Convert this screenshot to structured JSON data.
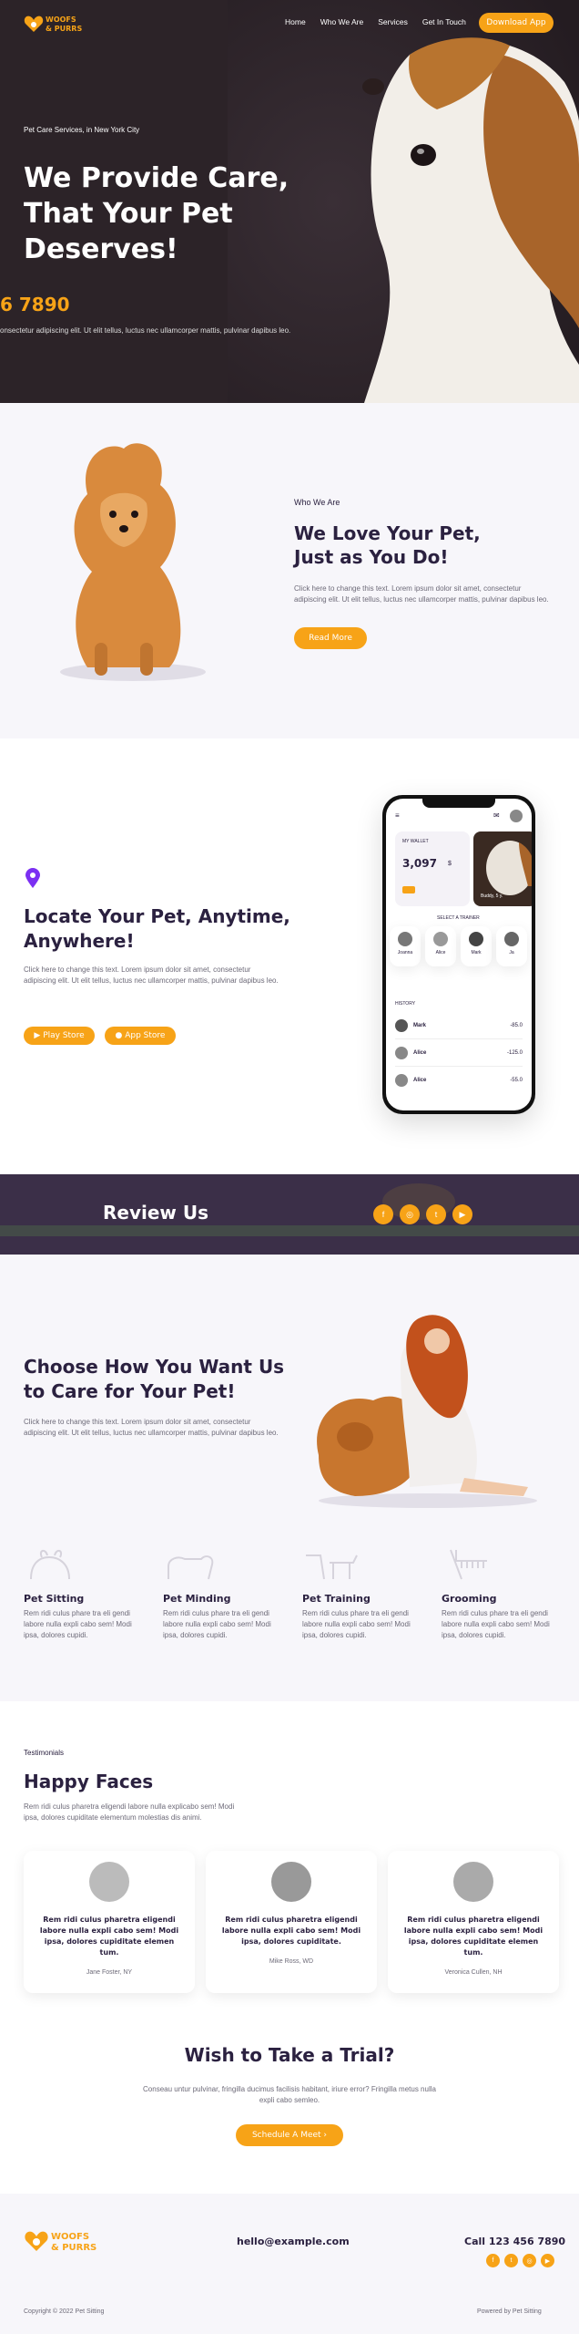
{
  "brand": {
    "logo_line1": "WOOFS",
    "logo_line2": "& PURRS"
  },
  "nav": {
    "items": [
      "Home",
      "Who We Are",
      "Services",
      "Get In Touch"
    ],
    "cta": "Download App"
  },
  "hero": {
    "eyebrow": "Pet Care Services, in New York City",
    "title_l1": "We Provide Care,",
    "title_l2": "That Your Pet",
    "title_l3": "Deserves!",
    "phone": "6 7890",
    "text": "onsectetur adipiscing elit. Ut elit tellus, luctus nec ullamcorper mattis, pulvinar dapibus leo."
  },
  "about": {
    "eyebrow": "Who We Are",
    "title_l1": "We Love Your Pet,",
    "title_l2": "Just as You Do!",
    "text": "Click here to change this text. Lorem ipsum dolor sit amet, consectetur adipiscing elit. Ut elit tellus, luctus nec ullamcorper mattis, pulvinar dapibus leo.",
    "button": "Read More"
  },
  "locate": {
    "title_l1": "Locate Your Pet, Anytime,",
    "title_l2": "Anywhere!",
    "text": "Click here to change this text. Lorem ipsum dolor sit amet, consectetur adipiscing elit. Ut elit tellus, luctus nec ullamcorper mattis, pulvinar dapibus leo.",
    "play": "Play Store",
    "app": "App Store"
  },
  "phone_app": {
    "wallet_label": "MY WALLET",
    "wallet_amount": "3,097",
    "wallet_currency": "$",
    "pet_name": "Buddy, 5 y.",
    "section": "SELECT A TRAINER",
    "trainers": [
      "Joanna",
      "Alice",
      "Mark",
      "Ja"
    ],
    "history_label": "HISTORY",
    "history": [
      {
        "name": "Mark",
        "amount": "-85.0"
      },
      {
        "name": "Alice",
        "amount": "-125.0"
      },
      {
        "name": "Alice",
        "amount": "-55.0"
      }
    ]
  },
  "review": {
    "title": "Review Us"
  },
  "choose": {
    "title_l1": "Choose How You Want Us",
    "title_l2": "to Care for Your Pet!",
    "text": "Click here to change this text. Lorem ipsum dolor sit amet, consectetur adipiscing elit. Ut elit tellus, luctus nec ullamcorper mattis, pulvinar dapibus leo."
  },
  "services": [
    {
      "title": "Pet Sitting",
      "text": "Rem ridi culus phare tra eli gendi labore nulla expli cabo sem! Modi ipsa, dolores cupidi."
    },
    {
      "title": "Pet Minding",
      "text": "Rem ridi culus phare tra eli gendi labore nulla expli cabo sem! Modi ipsa, dolores cupidi."
    },
    {
      "title": "Pet Training",
      "text": "Rem ridi culus phare tra eli gendi labore nulla expli cabo sem! Modi ipsa, dolores cupidi."
    },
    {
      "title": "Grooming",
      "text": "Rem ridi culus phare tra eli gendi labore nulla expli cabo sem! Modi ipsa, dolores cupidi."
    }
  ],
  "testimonials": {
    "eyebrow": "Testimonials",
    "title": "Happy Faces",
    "text": "Rem ridi culus pharetra eligendi labore nulla explicabo sem! Modi ipsa, dolores cupiditate elementum molestias dis animi.",
    "items": [
      {
        "quote": "Rem ridi culus pharetra eligendi labore nulla expli cabo sem! Modi ipsa, dolores cupiditate elemen tum.",
        "author": "Jane Foster, NY"
      },
      {
        "quote": "Rem ridi culus pharetra eligendi labore nulla expli cabo sem! Modi ipsa, dolores cupiditate.",
        "author": "Mike Ross, WD"
      },
      {
        "quote": "Rem ridi culus pharetra eligendi labore nulla expli cabo sem! Modi ipsa, dolores cupiditate elemen tum.",
        "author": "Veronica Cullen, NH"
      }
    ]
  },
  "trial": {
    "title": "Wish to Take a Trial?",
    "text": "Conseau untur pulvinar, fringilla ducimus facilisis habitant, iriure error? Fringilla metus nulla expli cabo semleo.",
    "button": "Schedule A Meet"
  },
  "footer": {
    "email": "hello@example.com",
    "phone": "Call 123 456 7890",
    "copyright": "Copyright © 2022 Pet Sitting",
    "powered": "Powered by Pet Sitting"
  },
  "colors": {
    "accent": "#f7a317",
    "dark": "#2b2140",
    "purple": "#7b2ff2"
  }
}
